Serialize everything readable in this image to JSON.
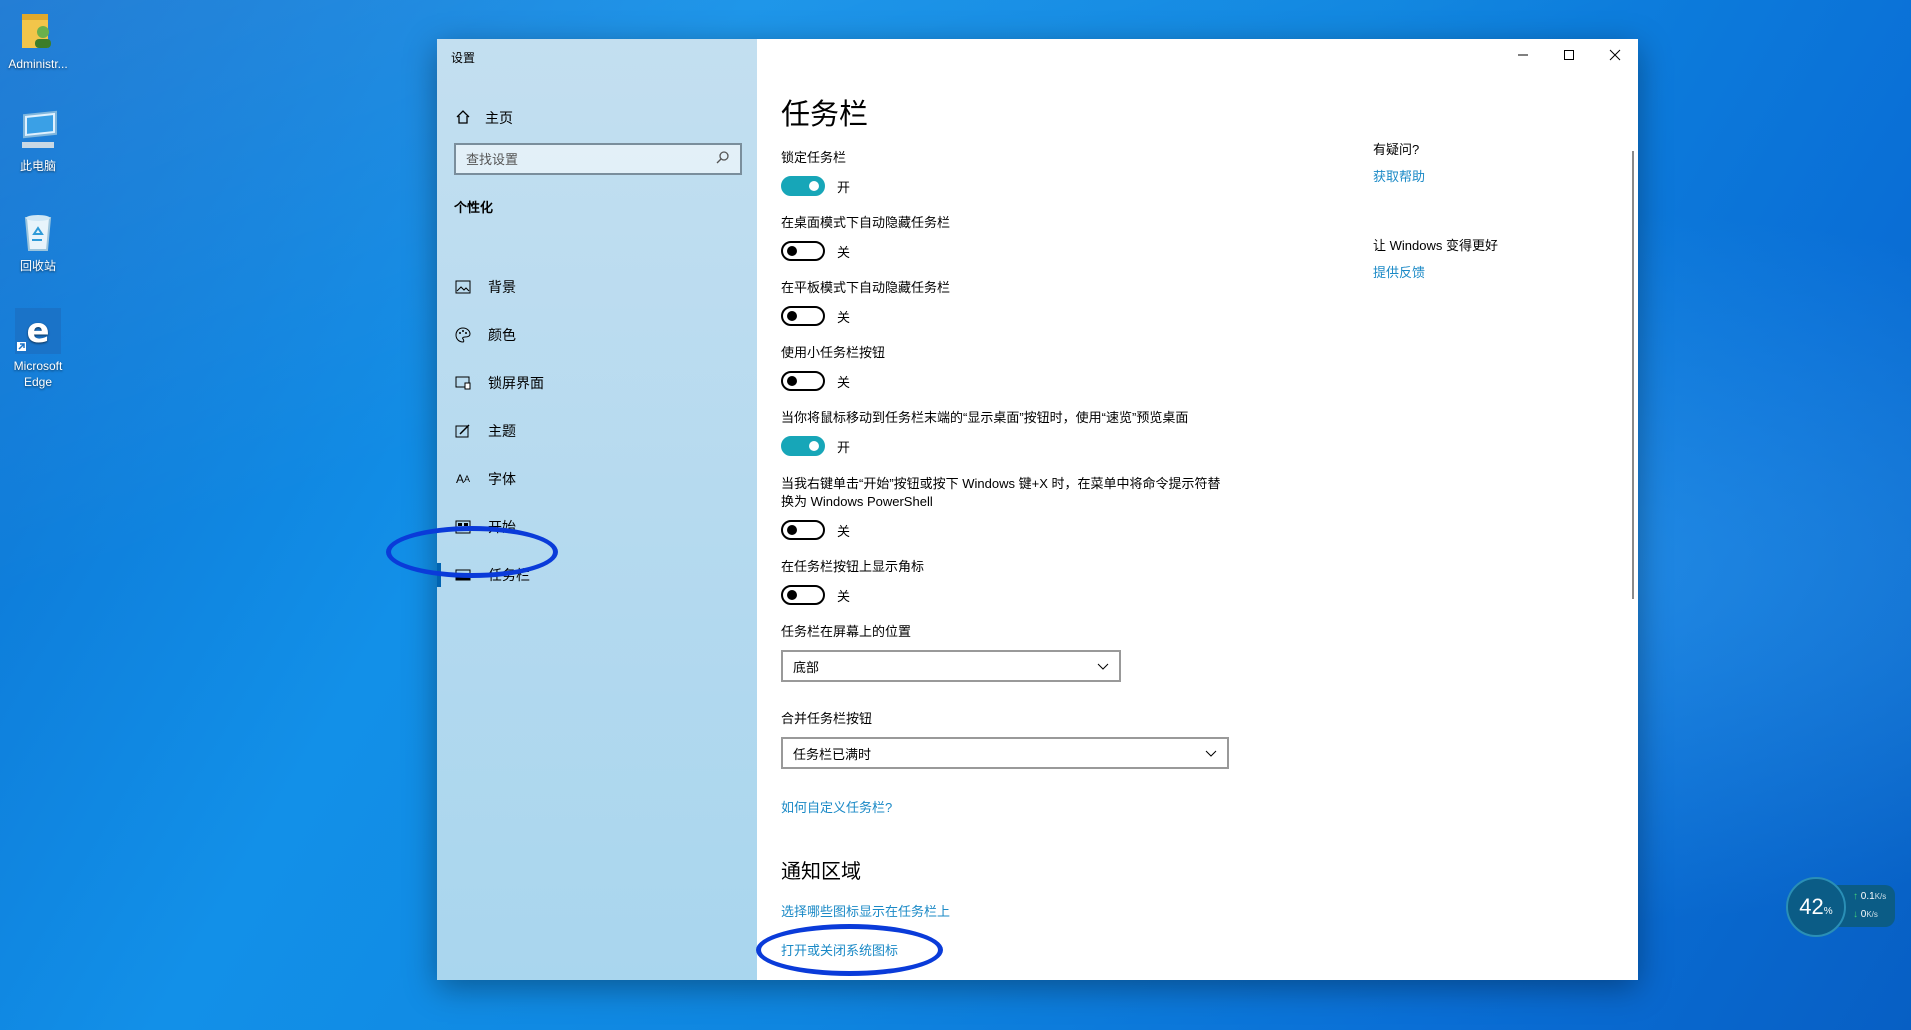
{
  "desktop": {
    "icons": [
      {
        "label": "Administr...",
        "icon": "user-folder-icon"
      },
      {
        "label": "此电脑",
        "icon": "this-pc-icon"
      },
      {
        "label": "回收站",
        "icon": "recycle-bin-icon"
      },
      {
        "label": "Microsoft Edge",
        "icon": "edge-icon"
      }
    ],
    "widget": {
      "cpu": "42",
      "cpu_unit": "%",
      "up": "0.1",
      "up_unit": "K/s",
      "down": "0",
      "down_unit": "K/s"
    }
  },
  "window": {
    "title": "设置",
    "sidebar": {
      "home": "主页",
      "search_placeholder": "查找设置",
      "section": "个性化",
      "items": [
        {
          "label": "背景",
          "icon": "picture-icon"
        },
        {
          "label": "颜色",
          "icon": "palette-icon"
        },
        {
          "label": "锁屏界面",
          "icon": "lock-screen-icon"
        },
        {
          "label": "主题",
          "icon": "theme-icon"
        },
        {
          "label": "字体",
          "icon": "font-icon"
        },
        {
          "label": "开始",
          "icon": "start-icon"
        },
        {
          "label": "任务栏",
          "icon": "taskbar-icon",
          "selected": true
        }
      ]
    },
    "main": {
      "title": "任务栏",
      "settings": [
        {
          "label": "锁定任务栏",
          "state": "开",
          "on": true
        },
        {
          "label": "在桌面模式下自动隐藏任务栏",
          "state": "关",
          "on": false
        },
        {
          "label": "在平板模式下自动隐藏任务栏",
          "state": "关",
          "on": false
        },
        {
          "label": "使用小任务栏按钮",
          "state": "关",
          "on": false
        },
        {
          "label": "当你将鼠标移动到任务栏末端的“显示桌面”按钮时，使用“速览”预览桌面",
          "state": "开",
          "on": true
        },
        {
          "label": "当我右键单击“开始”按钮或按下 Windows 键+X 时，在菜单中将命令提示符替换为 Windows PowerShell",
          "state": "关",
          "on": false
        },
        {
          "label": "在任务栏按钮上显示角标",
          "state": "关",
          "on": false
        }
      ],
      "position": {
        "label": "任务栏在屏幕上的位置",
        "value": "底部"
      },
      "combine": {
        "label": "合并任务栏按钮",
        "value": "任务栏已满时"
      },
      "customize_link": "如何自定义任务栏?",
      "notification": {
        "heading": "通知区域",
        "link1": "选择哪些图标显示在任务栏上",
        "link2": "打开或关闭系统图标"
      }
    },
    "aside": {
      "question": "有疑问?",
      "help_link": "获取帮助",
      "improve": "让 Windows 变得更好",
      "feedback_link": "提供反馈"
    }
  },
  "colors": {
    "toggle_on": "#17a6b8",
    "link": "#1a89c6",
    "annotation": "#0a3bd9"
  }
}
